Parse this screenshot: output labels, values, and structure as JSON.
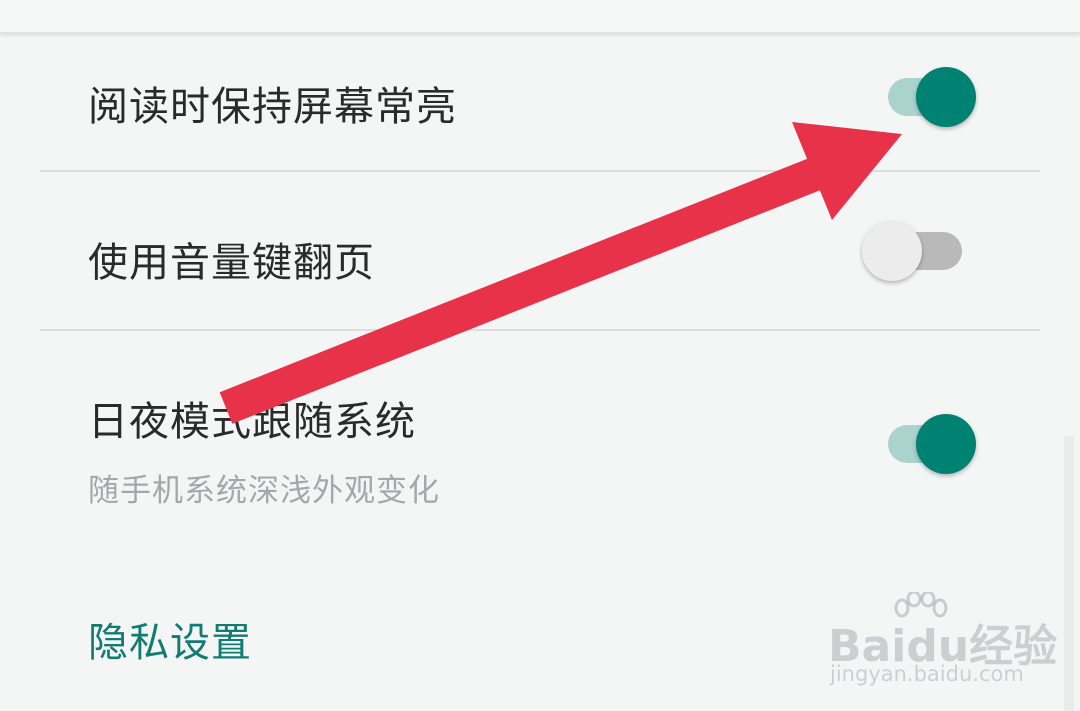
{
  "settings": {
    "items": [
      {
        "title": "阅读时保持屏幕常亮",
        "summary": "",
        "enabled": true
      },
      {
        "title": "使用音量键翻页",
        "summary": "",
        "enabled": false
      },
      {
        "title": "日夜模式跟随系统",
        "summary": "随手机系统深浅外观变化",
        "enabled": true
      }
    ],
    "next_section_title": "隐私设置"
  },
  "colors": {
    "accent": "#127c73",
    "switch_on_thumb": "#008272",
    "switch_on_track": "#a9d3cc",
    "switch_off_thumb": "#ececec",
    "switch_off_track": "#b9b9b9",
    "annotation_arrow": "#e8324a"
  },
  "watermark": {
    "logo_text": "Baidu经验",
    "url": "jingyan.baidu.com"
  },
  "icons": {
    "annotation": "red-arrow-icon",
    "watermark": "baidu-paw-icon"
  }
}
